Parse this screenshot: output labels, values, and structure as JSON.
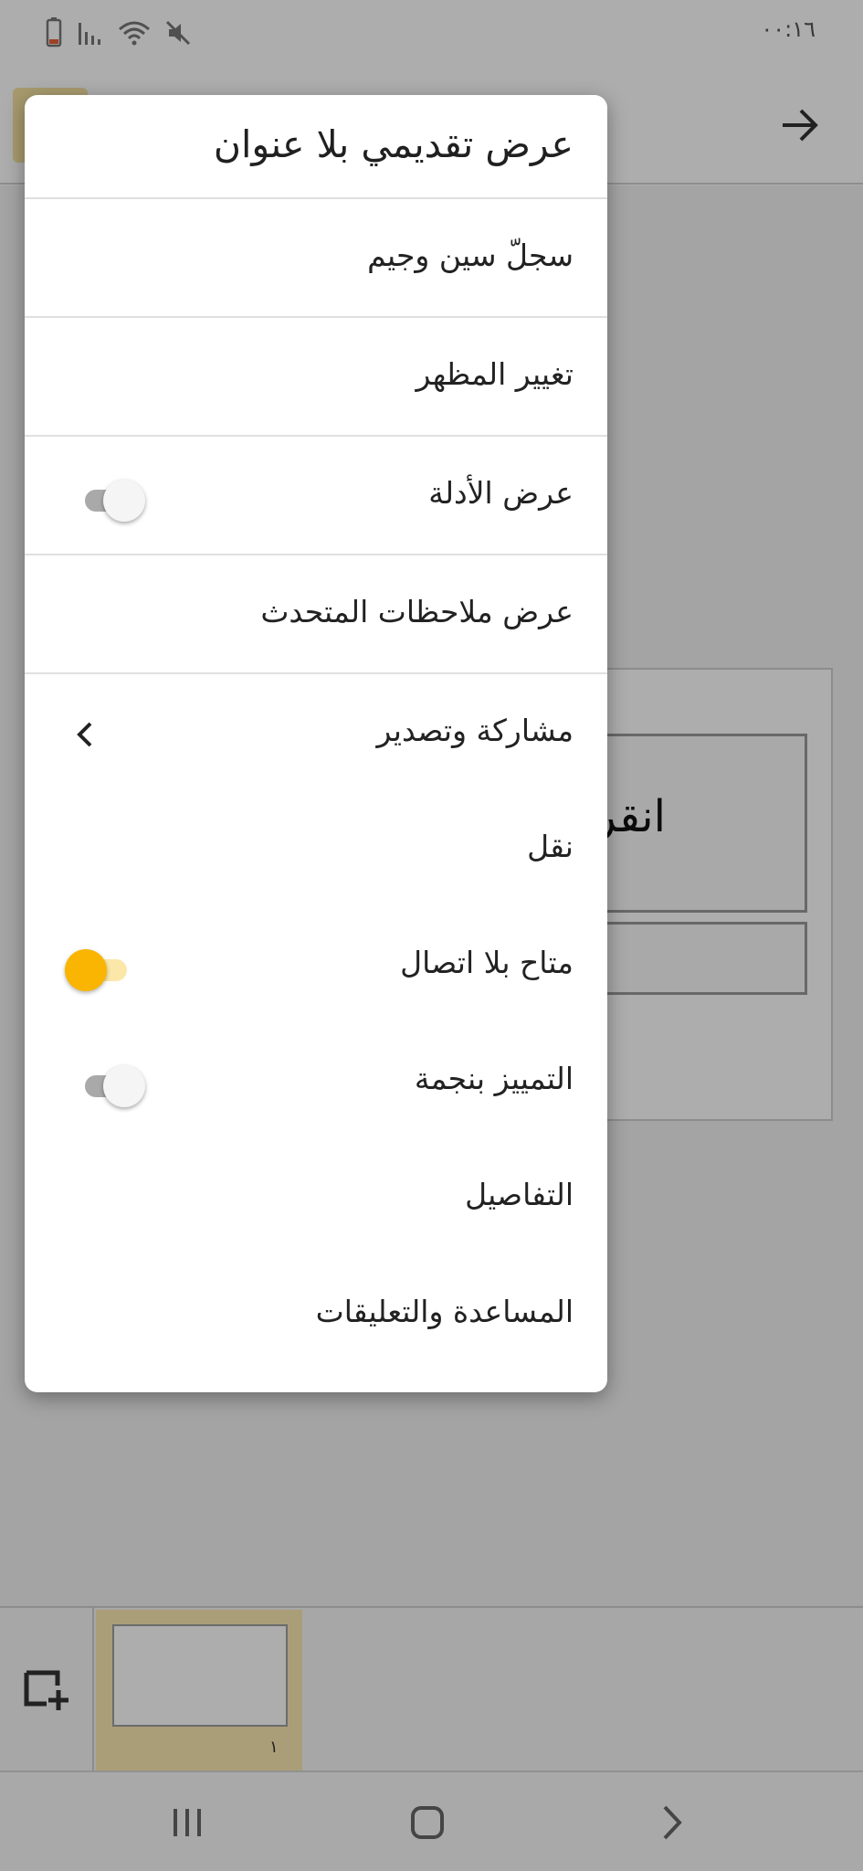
{
  "status_bar": {
    "time": "٠٠:١٦",
    "icons": [
      "battery-icon",
      "signal-icon",
      "wifi-icon",
      "mute-icon"
    ]
  },
  "toolbar": {
    "back_icon": "arrow-right-icon"
  },
  "slide": {
    "title_placeholder": "انقر"
  },
  "filmstrip": {
    "add_icon": "add-slide-icon",
    "slides": [
      {
        "number": "١"
      }
    ]
  },
  "navbar": {
    "icons": [
      "recents-icon",
      "home-icon",
      "back-icon"
    ]
  },
  "menu": {
    "title": "عرض تقديمي بلا عنوان",
    "items": [
      {
        "label": "سجلّ سين وجيم",
        "control": "none"
      },
      {
        "label": "تغيير المظهر",
        "control": "none"
      },
      {
        "label": "عرض الأدلة",
        "control": "switch",
        "checked": false
      },
      {
        "label": "عرض ملاحظات المتحدث",
        "control": "none"
      },
      {
        "label": "مشاركة وتصدير",
        "control": "submenu"
      },
      {
        "label": "نقل",
        "control": "none"
      },
      {
        "label": "متاح بلا اتصال",
        "control": "switch",
        "checked": true
      },
      {
        "label": "التمييز بنجمة",
        "control": "switch",
        "checked": false
      },
      {
        "label": "التفاصيل",
        "control": "none"
      },
      {
        "label": "المساعدة والتعليقات",
        "control": "none"
      }
    ]
  },
  "colors": {
    "accent": "#f9b501",
    "accent_track": "#fbe7a8",
    "scrim": "rgba(0,0,0,0.32)",
    "menu_bg": "#ffffff"
  }
}
